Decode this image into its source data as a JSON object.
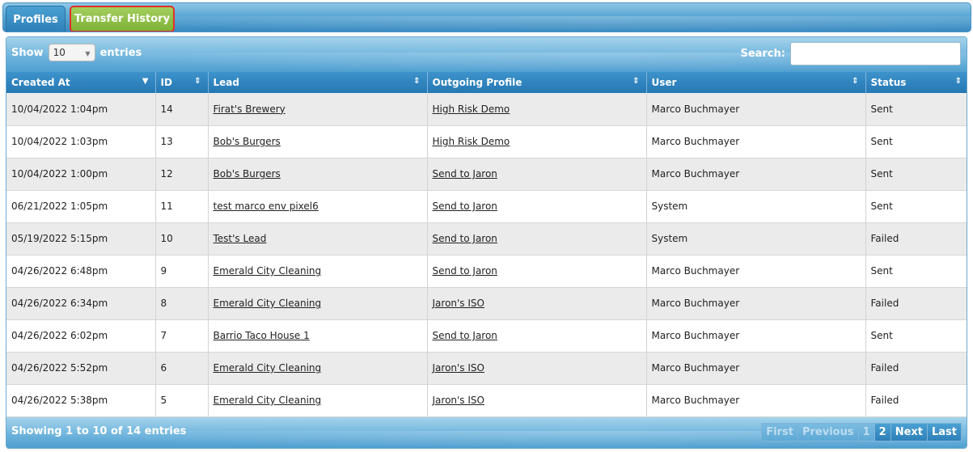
{
  "tabs": [
    {
      "label": "Profiles"
    },
    {
      "label": "Transfer History"
    }
  ],
  "toolbar": {
    "show_label": "Show",
    "entries_label": "entries",
    "length_value": "10",
    "search_label": "Search:",
    "search_value": ""
  },
  "columns": [
    "Created At",
    "ID",
    "Lead",
    "Outgoing Profile",
    "User",
    "Status"
  ],
  "rows": [
    {
      "created": "10/04/2022 1:04pm",
      "id": "14",
      "lead": "Firat's Brewery",
      "profile": "High Risk Demo",
      "user": "Marco Buchmayer",
      "status": "Sent"
    },
    {
      "created": "10/04/2022 1:03pm",
      "id": "13",
      "lead": "Bob's Burgers",
      "profile": "High Risk Demo",
      "user": "Marco Buchmayer",
      "status": "Sent"
    },
    {
      "created": "10/04/2022 1:00pm",
      "id": "12",
      "lead": "Bob's Burgers",
      "profile": "Send to Jaron",
      "user": "Marco Buchmayer",
      "status": "Sent"
    },
    {
      "created": "06/21/2022 1:05pm",
      "id": "11",
      "lead": "test marco env pixel6",
      "profile": "Send to Jaron",
      "user": "System",
      "status": "Sent"
    },
    {
      "created": "05/19/2022 5:15pm",
      "id": "10",
      "lead": "Test's Lead",
      "profile": "Send to Jaron",
      "user": "System",
      "status": "Failed"
    },
    {
      "created": "04/26/2022 6:48pm",
      "id": "9",
      "lead": "Emerald City Cleaning",
      "profile": "Send to Jaron",
      "user": "Marco Buchmayer",
      "status": "Sent"
    },
    {
      "created": "04/26/2022 6:34pm",
      "id": "8",
      "lead": "Emerald City Cleaning",
      "profile": "Jaron's ISO",
      "user": "Marco Buchmayer",
      "status": "Failed"
    },
    {
      "created": "04/26/2022 6:02pm",
      "id": "7",
      "lead": "Barrio Taco House 1",
      "profile": "Send to Jaron",
      "user": "Marco Buchmayer",
      "status": "Sent"
    },
    {
      "created": "04/26/2022 5:52pm",
      "id": "6",
      "lead": "Emerald City Cleaning",
      "profile": "Jaron's ISO",
      "user": "Marco Buchmayer",
      "status": "Failed"
    },
    {
      "created": "04/26/2022 5:38pm",
      "id": "5",
      "lead": "Emerald City Cleaning",
      "profile": "Jaron's ISO",
      "user": "Marco Buchmayer",
      "status": "Failed"
    }
  ],
  "footer": {
    "info": "Showing 1 to 10 of 14 entries",
    "first": "First",
    "previous": "Previous",
    "page1": "1",
    "page2": "2",
    "next": "Next",
    "last": "Last"
  },
  "colors": {
    "tab_active": "#8bc34a",
    "tab_highlight_border": "#e0302a",
    "header_blue": "#2577b3"
  },
  "icons": {
    "sort_desc": "triangle-down-icon",
    "sort_both": "sort-arrows-icon",
    "select_caret": "caret-down-icon"
  }
}
